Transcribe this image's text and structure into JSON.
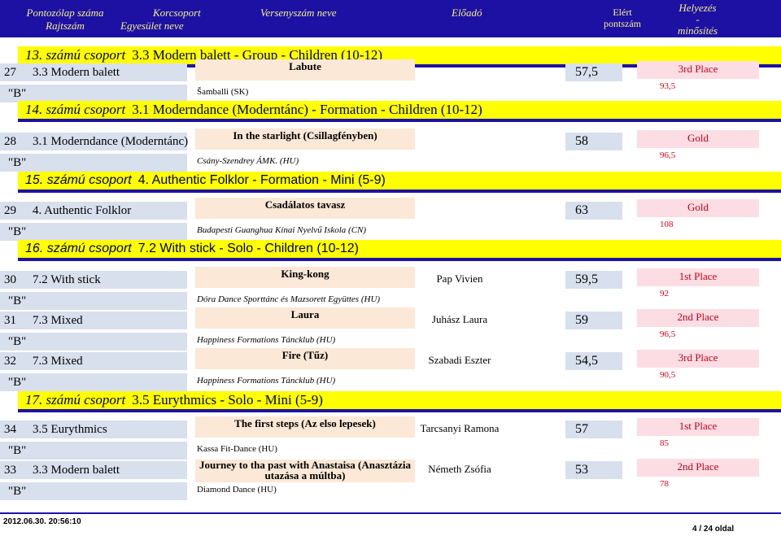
{
  "header": {
    "col_number_line1": "Pontozólap száma",
    "col_number_line2": "Rajtszám",
    "col_category_line1": "Korcsoport",
    "col_category_line2": "Egyesület neve",
    "col_piece": "Versenyszám neve",
    "col_performer": "Előadó",
    "col_points_line1": "Elért",
    "col_points_line2": "pontszám",
    "col_rank_line1": "Helyezés",
    "col_rank_line2": "-",
    "col_rank_line3": "minősítés"
  },
  "groups": [
    {
      "num": "13. számú csoport",
      "name": "3.3 Modern balett - Group - Children (10-12)",
      "entries": [
        {
          "start": "27",
          "category": "3.3 Modern balett",
          "class": "\"B\"",
          "piece": "Labute",
          "club": "Šamballi (SK)",
          "performer": "",
          "points": "57,5",
          "place": "3rd Place",
          "score": "93,5"
        }
      ]
    },
    {
      "num": "14. számú csoport",
      "name": "3.1 Moderndance (Moderntánc) - Formation - Children (10-12)",
      "entries": [
        {
          "start": "28",
          "category": "3.1 Moderndance (Moderntánc)",
          "class": "\"B\"",
          "piece": "In the starlight (Csillagfényben)",
          "club": "Csány-Szendrey ÁMK. (HU)",
          "performer": "",
          "points": "58",
          "place": "Gold",
          "score": "96,5"
        }
      ]
    },
    {
      "num": "15. számú csoport",
      "name": "4. Authentic Folklor - Formation - Mini (5-9)",
      "entries": [
        {
          "start": "29",
          "category": "4. Authentic Folklor",
          "class": "\"B\"",
          "piece": "Csadálatos tavasz",
          "club": "Budapesti Guanghua Kínai Nyelvű Iskola (CN)",
          "performer": "",
          "points": "63",
          "place": "Gold",
          "score": "108"
        }
      ]
    },
    {
      "num": "16. számú csoport",
      "name": "7.2 With stick - Solo - Children (10-12)",
      "entries": [
        {
          "start": "30",
          "category": "7.2 With stick",
          "class": "\"B\"",
          "piece": "King-kong",
          "club": "Dóra Dance Sporttánc és Mazsorett Együttes (HU)",
          "performer": "Pap Vivien",
          "points": "59,5",
          "place": "1st Place",
          "score": "92"
        },
        {
          "start": "31",
          "category": "7.3 Mixed",
          "class": "\"B\"",
          "piece": "Laura",
          "club": "Happiness Formations Táncklub (HU)",
          "performer": "Juhász Laura",
          "points": "59",
          "place": "2nd Place",
          "score": "96,5"
        },
        {
          "start": "32",
          "category": "7.3 Mixed",
          "class": "\"B\"",
          "piece": "Fire (Tűz)",
          "club": "Happiness Formations Táncklub (HU)",
          "performer": "Szabadi Eszter",
          "points": "54,5",
          "place": "3rd Place",
          "score": "90,5"
        }
      ]
    },
    {
      "num": "17. számú csoport",
      "name": "3.5 Eurythmics - Solo - Mini (5-9)",
      "entries": [
        {
          "start": "34",
          "category": "3.5 Eurythmics",
          "class": "\"B\"",
          "piece": "The first steps (Az elso lepesek)",
          "club": "Kassa Fit-Dance (HU)",
          "performer": "Tarcsanyi Ramona",
          "points": "57",
          "place": "1st Place",
          "score": "85"
        },
        {
          "start": "33",
          "category": "3.3 Modern balett",
          "class": "\"B\"",
          "piece": "Journey to tha past with Anastaisa (Anasztázia utazása a múltba)",
          "club": "Diamond Dance (HU)",
          "performer": "Németh Zsófia",
          "points": "53",
          "place": "2nd Place",
          "score": "78"
        }
      ]
    }
  ],
  "footer": {
    "timestamp": "2012.06.30. 20:56:10",
    "page": "4 / 24 oldal"
  }
}
